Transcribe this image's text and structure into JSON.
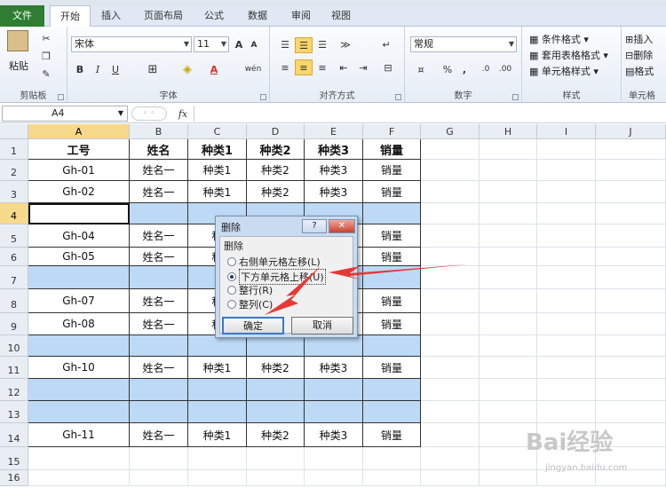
{
  "tabs": [
    "文件",
    "开始",
    "插入",
    "页面布局",
    "公式",
    "数据",
    "审阅",
    "视图"
  ],
  "ribbon": {
    "clipboard": {
      "label": "剪贴板",
      "paste": "粘贴"
    },
    "font": {
      "label": "字体",
      "name": "宋体",
      "size": "11",
      "bold": "B",
      "italic": "I",
      "underline": "U",
      "grow": "A",
      "shrink": "A",
      "font_color": "A",
      "phonetic": "wén"
    },
    "alignment": {
      "label": "对齐方式"
    },
    "number": {
      "label": "数字",
      "format": "常规",
      "percent": "%",
      "comma": ","
    },
    "styles": {
      "label": "样式",
      "conditional": "条件格式",
      "table": "套用表格格式",
      "cell": "单元格样式"
    },
    "cells": {
      "label": "单元格",
      "insert": "插入",
      "delete": "删除",
      "format": "格式"
    }
  },
  "formula_bar": {
    "name_box": "A4",
    "fx": "fx",
    "formula": ""
  },
  "columns": [
    "A",
    "B",
    "C",
    "D",
    "E",
    "F",
    "G",
    "H",
    "I",
    "J"
  ],
  "rows": [
    "1",
    "2",
    "3",
    "4",
    "5",
    "6",
    "7",
    "8",
    "9",
    "10",
    "11",
    "12",
    "13",
    "14",
    "15",
    "16"
  ],
  "cells": {
    "r1": [
      "工号",
      "姓名",
      "种类1",
      "种类2",
      "种类3",
      "销量"
    ],
    "r2": [
      "Gh-01",
      "姓名一",
      "种类1",
      "种类2",
      "种类3",
      "销量"
    ],
    "r3": [
      "Gh-02",
      "姓名一",
      "种类1",
      "种类2",
      "种类3",
      "销量"
    ],
    "r5": [
      "Gh-04",
      "姓名一",
      "种",
      "",
      "",
      "销量"
    ],
    "r6": [
      "Gh-05",
      "姓名一",
      "种",
      "",
      "",
      "销量"
    ],
    "r8": [
      "Gh-07",
      "姓名一",
      "种",
      "",
      "",
      "销量"
    ],
    "r9": [
      "Gh-08",
      "姓名一",
      "种",
      "",
      "",
      "销量"
    ],
    "r11": [
      "Gh-10",
      "姓名一",
      "种类1",
      "种类2",
      "种类3",
      "销量"
    ],
    "r14": [
      "Gh-11",
      "姓名一",
      "种类1",
      "种类2",
      "种类3",
      "销量"
    ]
  },
  "dialog": {
    "title": "删除",
    "help": "?",
    "close": "✕",
    "group": "删除",
    "options": [
      "右侧单元格左移(L)",
      "下方单元格上移(U)",
      "整行(R)",
      "整列(C)"
    ],
    "selected_index": 1,
    "ok": "确定",
    "cancel": "取消"
  },
  "watermark": {
    "brand": "Bai经验",
    "url": "jingyan.baidu.com"
  },
  "colors": {
    "file_tab": "#2e7d32",
    "selected_header": "#f6d98a",
    "blank_row": "#bcd9f5",
    "arrow": "#e53935"
  }
}
